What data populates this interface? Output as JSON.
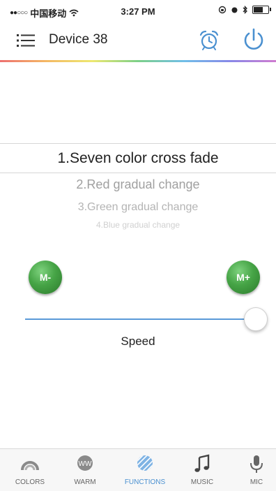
{
  "status_bar": {
    "carrier": "中国移动",
    "time": "3:27 PM",
    "battery_level": 0.7
  },
  "navbar": {
    "title": "Device 38",
    "menu_icon": "menu-list-icon",
    "alarm_icon": "alarm-clock-icon",
    "power_icon": "power-icon"
  },
  "picker": {
    "items": [
      "1.Seven color cross fade",
      "2.Red  gradual change",
      "3.Green gradual change",
      "4.Blue gradual change"
    ],
    "selected_index": 0
  },
  "controls": {
    "minus_label": "M-",
    "plus_label": "M+",
    "speed_label": "Speed",
    "speed_value": 1.0
  },
  "tabbar": {
    "tabs": [
      {
        "label": "COLORS",
        "icon": "rainbow-arc-icon"
      },
      {
        "label": "WARM",
        "icon": "ww-circle-icon"
      },
      {
        "label": "FUNCTIONS",
        "icon": "striped-circle-icon"
      },
      {
        "label": "MUSIC",
        "icon": "music-note-icon"
      },
      {
        "label": "MIC",
        "icon": "microphone-icon"
      }
    ],
    "active_index": 2
  },
  "colors": {
    "accent": "#4a90d0",
    "button_green": "#46a446",
    "slider_track": "#5a9ad8"
  }
}
